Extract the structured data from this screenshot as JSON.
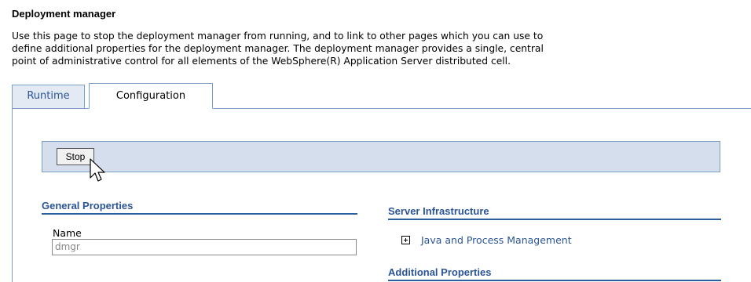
{
  "page": {
    "title": "Deployment manager",
    "description_lines": [
      "Use this page to stop the deployment manager from running, and to link to other pages which you can use to",
      "define additional properties for the deployment manager. The deployment manager provides a single, central",
      "point of administrative control for all elements of the WebSphere(R) Application Server distributed cell."
    ]
  },
  "tabs": [
    {
      "label": "Runtime",
      "selected": false
    },
    {
      "label": "Configuration",
      "selected": true
    }
  ],
  "toolbar": {
    "stop_label": "Stop"
  },
  "general_properties": {
    "header": "General Properties",
    "name_label": "Name",
    "name_value": "dmgr"
  },
  "server_infrastructure": {
    "header": "Server Infrastructure",
    "links": [
      {
        "label": "Java and Process Management",
        "icon": "expand-plus-icon"
      }
    ]
  },
  "additional_properties": {
    "header": "Additional Properties"
  },
  "colors": {
    "accent": "#2b5596",
    "tab_border": "#7b9ec5",
    "button_bar_bg": "#d5deed"
  }
}
